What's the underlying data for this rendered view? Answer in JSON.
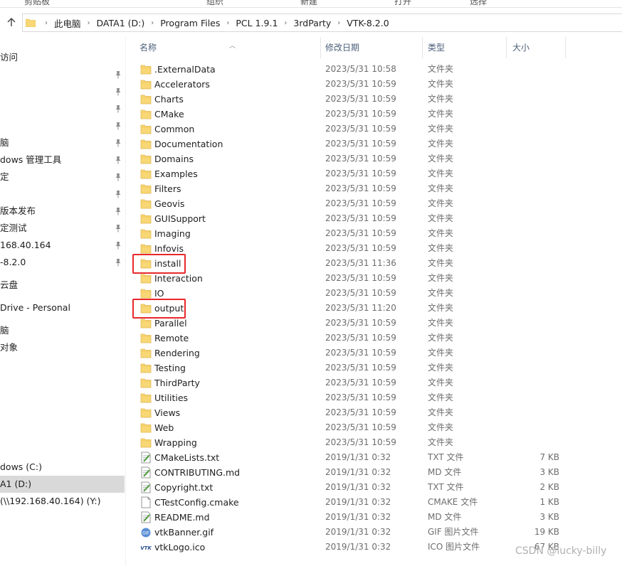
{
  "ribbon": {
    "labels": [
      "剪贴板",
      "组织",
      "新建",
      "打开",
      "选择"
    ]
  },
  "address": {
    "crumbs": [
      "此电脑",
      "DATA1 (D:)",
      "Program Files",
      "PCL 1.9.1",
      "3rdParty",
      "VTK-8.2.0"
    ]
  },
  "sidebar": {
    "items": [
      {
        "label": "访问",
        "pinned": false,
        "selected": false
      },
      {
        "label": "",
        "pinned": true,
        "selected": false
      },
      {
        "label": "",
        "pinned": true,
        "selected": false
      },
      {
        "label": "",
        "pinned": true,
        "selected": false
      },
      {
        "label": "",
        "pinned": true,
        "selected": false
      },
      {
        "label": "脑",
        "pinned": true,
        "selected": false
      },
      {
        "label": "dows 管理工具",
        "pinned": true,
        "selected": false
      },
      {
        "label": "定",
        "pinned": true,
        "selected": false
      },
      {
        "label": "",
        "pinned": true,
        "selected": false
      },
      {
        "label": "版本发布",
        "pinned": true,
        "selected": false
      },
      {
        "label": "定测试",
        "pinned": true,
        "selected": false
      },
      {
        "label": "168.40.164",
        "pinned": true,
        "selected": false
      },
      {
        "label": "-8.2.0",
        "pinned": true,
        "selected": false
      },
      {
        "label": "云盘",
        "pinned": false,
        "selected": false
      },
      {
        "label": "Drive - Personal",
        "pinned": false,
        "selected": false
      },
      {
        "label": "脑",
        "pinned": false,
        "selected": false
      },
      {
        "label": "对象",
        "pinned": false,
        "selected": false
      },
      {
        "label": "",
        "pinned": false,
        "selected": false
      },
      {
        "label": "",
        "pinned": false,
        "selected": false
      },
      {
        "label": "",
        "pinned": false,
        "selected": false
      },
      {
        "label": "",
        "pinned": false,
        "selected": false
      },
      {
        "label": "",
        "pinned": false,
        "selected": false
      },
      {
        "label": "",
        "pinned": false,
        "selected": false
      },
      {
        "label": "dows (C:)",
        "pinned": false,
        "selected": false
      },
      {
        "label": "A1 (D:)",
        "pinned": false,
        "selected": true
      },
      {
        "label": "(\\\\192.168.40.164) (Y:)",
        "pinned": false,
        "selected": false
      }
    ]
  },
  "columns": {
    "name": "名称",
    "date": "修改日期",
    "type": "类型",
    "size": "大小"
  },
  "files": [
    {
      "name": ".ExternalData",
      "date": "2023/5/31 10:58",
      "type": "文件夹",
      "size": "",
      "icon": "folder-icon",
      "highlighted": false
    },
    {
      "name": "Accelerators",
      "date": "2023/5/31 10:59",
      "type": "文件夹",
      "size": "",
      "icon": "folder-icon",
      "highlighted": false
    },
    {
      "name": "Charts",
      "date": "2023/5/31 10:59",
      "type": "文件夹",
      "size": "",
      "icon": "folder-icon",
      "highlighted": false
    },
    {
      "name": "CMake",
      "date": "2023/5/31 10:59",
      "type": "文件夹",
      "size": "",
      "icon": "folder-icon",
      "highlighted": false
    },
    {
      "name": "Common",
      "date": "2023/5/31 10:59",
      "type": "文件夹",
      "size": "",
      "icon": "folder-icon",
      "highlighted": false
    },
    {
      "name": "Documentation",
      "date": "2023/5/31 10:59",
      "type": "文件夹",
      "size": "",
      "icon": "folder-icon",
      "highlighted": false
    },
    {
      "name": "Domains",
      "date": "2023/5/31 10:59",
      "type": "文件夹",
      "size": "",
      "icon": "folder-icon",
      "highlighted": false
    },
    {
      "name": "Examples",
      "date": "2023/5/31 10:59",
      "type": "文件夹",
      "size": "",
      "icon": "folder-icon",
      "highlighted": false
    },
    {
      "name": "Filters",
      "date": "2023/5/31 10:59",
      "type": "文件夹",
      "size": "",
      "icon": "folder-icon",
      "highlighted": false
    },
    {
      "name": "Geovis",
      "date": "2023/5/31 10:59",
      "type": "文件夹",
      "size": "",
      "icon": "folder-icon",
      "highlighted": false
    },
    {
      "name": "GUISupport",
      "date": "2023/5/31 10:59",
      "type": "文件夹",
      "size": "",
      "icon": "folder-icon",
      "highlighted": false
    },
    {
      "name": "Imaging",
      "date": "2023/5/31 10:59",
      "type": "文件夹",
      "size": "",
      "icon": "folder-icon",
      "highlighted": false
    },
    {
      "name": "Infovis",
      "date": "2023/5/31 10:59",
      "type": "文件夹",
      "size": "",
      "icon": "folder-icon",
      "highlighted": false
    },
    {
      "name": "install",
      "date": "2023/5/31 11:36",
      "type": "文件夹",
      "size": "",
      "icon": "folder-icon",
      "highlighted": true
    },
    {
      "name": "Interaction",
      "date": "2023/5/31 10:59",
      "type": "文件夹",
      "size": "",
      "icon": "folder-icon",
      "highlighted": false
    },
    {
      "name": "IO",
      "date": "2023/5/31 10:59",
      "type": "文件夹",
      "size": "",
      "icon": "folder-icon",
      "highlighted": false
    },
    {
      "name": "output",
      "date": "2023/5/31 11:20",
      "type": "文件夹",
      "size": "",
      "icon": "folder-icon",
      "highlighted": true
    },
    {
      "name": "Parallel",
      "date": "2023/5/31 10:59",
      "type": "文件夹",
      "size": "",
      "icon": "folder-icon",
      "highlighted": false
    },
    {
      "name": "Remote",
      "date": "2023/5/31 10:59",
      "type": "文件夹",
      "size": "",
      "icon": "folder-icon",
      "highlighted": false
    },
    {
      "name": "Rendering",
      "date": "2023/5/31 10:59",
      "type": "文件夹",
      "size": "",
      "icon": "folder-icon",
      "highlighted": false
    },
    {
      "name": "Testing",
      "date": "2023/5/31 10:59",
      "type": "文件夹",
      "size": "",
      "icon": "folder-icon",
      "highlighted": false
    },
    {
      "name": "ThirdParty",
      "date": "2023/5/31 10:59",
      "type": "文件夹",
      "size": "",
      "icon": "folder-icon",
      "highlighted": false
    },
    {
      "name": "Utilities",
      "date": "2023/5/31 10:59",
      "type": "文件夹",
      "size": "",
      "icon": "folder-icon",
      "highlighted": false
    },
    {
      "name": "Views",
      "date": "2023/5/31 10:59",
      "type": "文件夹",
      "size": "",
      "icon": "folder-icon",
      "highlighted": false
    },
    {
      "name": "Web",
      "date": "2023/5/31 10:59",
      "type": "文件夹",
      "size": "",
      "icon": "folder-icon",
      "highlighted": false
    },
    {
      "name": "Wrapping",
      "date": "2023/5/31 10:59",
      "type": "文件夹",
      "size": "",
      "icon": "folder-icon",
      "highlighted": false
    },
    {
      "name": "CMakeLists.txt",
      "date": "2019/1/31 0:32",
      "type": "TXT 文件",
      "size": "7 KB",
      "icon": "text-file-icon",
      "highlighted": false
    },
    {
      "name": "CONTRIBUTING.md",
      "date": "2019/1/31 0:32",
      "type": "MD 文件",
      "size": "3 KB",
      "icon": "text-file-icon",
      "highlighted": false
    },
    {
      "name": "Copyright.txt",
      "date": "2019/1/31 0:32",
      "type": "TXT 文件",
      "size": "2 KB",
      "icon": "text-file-icon",
      "highlighted": false
    },
    {
      "name": "CTestConfig.cmake",
      "date": "2019/1/31 0:32",
      "type": "CMAKE 文件",
      "size": "1 KB",
      "icon": "blank-file-icon",
      "highlighted": false
    },
    {
      "name": "README.md",
      "date": "2019/1/31 0:32",
      "type": "MD 文件",
      "size": "3 KB",
      "icon": "text-file-icon",
      "highlighted": false
    },
    {
      "name": "vtkBanner.gif",
      "date": "2019/1/31 0:32",
      "type": "GIF 图片文件",
      "size": "19 KB",
      "icon": "gif-file-icon",
      "highlighted": false
    },
    {
      "name": "vtkLogo.ico",
      "date": "2019/1/31 0:32",
      "type": "ICO 图片文件",
      "size": "67 KB",
      "icon": "ico-file-icon",
      "highlighted": false
    }
  ],
  "watermark": "CSDN @lucky-billy",
  "colors": {
    "highlight": "#e8282b",
    "folder": "#f8d775",
    "selected_bg": "#d9d9d9"
  }
}
